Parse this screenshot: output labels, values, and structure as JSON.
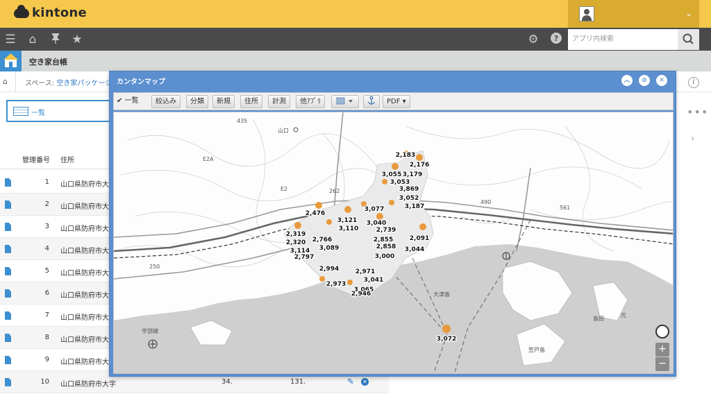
{
  "header": {
    "logo_text": "kintone"
  },
  "nav": {
    "search_placeholder": "アプリ内検索"
  },
  "app": {
    "title": "空き家台帳"
  },
  "breadcrumb": {
    "prefix": "スペース:",
    "space": "空き家パッケージ"
  },
  "view": {
    "label": "一覧"
  },
  "table": {
    "headers": [
      "管理番号",
      "住所"
    ],
    "rows": [
      {
        "num": "1",
        "address": "山口県防府市大字"
      },
      {
        "num": "2",
        "address": "山口県防府市大字"
      },
      {
        "num": "3",
        "address": "山口県防府市大字"
      },
      {
        "num": "4",
        "address": "山口県防府市大字"
      },
      {
        "num": "5",
        "address": "山口県防府市大字"
      },
      {
        "num": "6",
        "address": "山口県防府市大字"
      },
      {
        "num": "7",
        "address": "山口県防府市大字"
      },
      {
        "num": "8",
        "address": "山口県防府市大字"
      },
      {
        "num": "9",
        "address": "山口県防府市大字"
      },
      {
        "num": "10",
        "address": "山口県防府市大字",
        "col3": "34.",
        "col4": "131."
      }
    ]
  },
  "map_dialog": {
    "title": "カンタンマップ",
    "toolbar": {
      "list": "一覧",
      "filter": "絞込み",
      "classify": "分類",
      "new": "新規",
      "address": "住所",
      "measure": "計測",
      "other_app": "他ｱﾌﾟﾘ",
      "pdf": "PDF"
    },
    "place_labels": {
      "yamaguchi": "山口",
      "oozushima": "大津島",
      "kasadojima": "笠戸島",
      "shimata": "島田",
      "hikari": "光",
      "ubenosen": "宇部線",
      "road435": "435",
      "road262": "262",
      "road490": "490",
      "e2a": "E2A",
      "e2": "E2",
      "road561": "561",
      "road250": "250"
    },
    "clusters": [
      {
        "label": "2,183"
      },
      {
        "label": "2,176"
      },
      {
        "label": "3,179"
      },
      {
        "label": "3,055"
      },
      {
        "label": "3,053"
      },
      {
        "label": "3,869"
      },
      {
        "label": "3,052"
      },
      {
        "label": "3,187"
      },
      {
        "label": "2,476"
      },
      {
        "label": "3,121"
      },
      {
        "label": "3,110"
      },
      {
        "label": "3,077"
      },
      {
        "label": "3,040"
      },
      {
        "label": "2,739"
      },
      {
        "label": "2,319"
      },
      {
        "label": "2,320"
      },
      {
        "label": "2,766"
      },
      {
        "label": "3,114"
      },
      {
        "label": "3,089"
      },
      {
        "label": "2,858"
      },
      {
        "label": "2,855"
      },
      {
        "label": "3,044"
      },
      {
        "label": "2,797"
      },
      {
        "label": "2,994"
      },
      {
        "label": "3,000"
      },
      {
        "label": "2,971"
      },
      {
        "label": "3,041"
      },
      {
        "label": "2,973"
      },
      {
        "label": "3,065"
      },
      {
        "label": "2,946"
      },
      {
        "label": "2,091"
      },
      {
        "label": "3,072"
      }
    ]
  }
}
